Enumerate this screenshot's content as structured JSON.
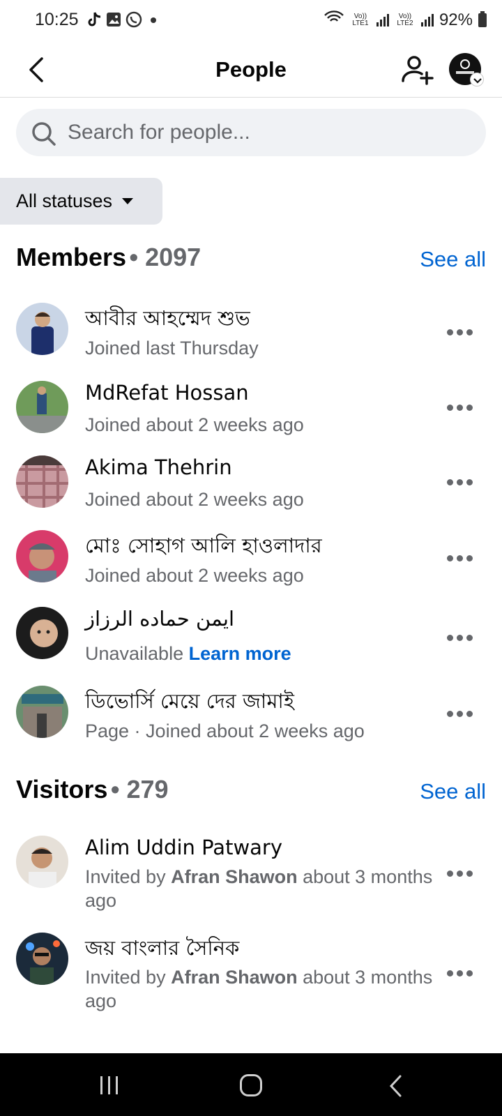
{
  "status_bar": {
    "time": "10:25",
    "lte1": "Vo)) LTE1",
    "lte2": "Vo)) LTE2",
    "battery": "92%"
  },
  "header": {
    "title": "People"
  },
  "search": {
    "placeholder": "Search for people..."
  },
  "filter": {
    "label": "All statuses"
  },
  "members": {
    "title": "Members",
    "count": "• 2097",
    "see_all": "See all",
    "items": [
      {
        "name": "আবীর আহম্মেদ শুভ",
        "sub": "Joined last Thursday"
      },
      {
        "name": "MdRefat Hossan",
        "sub": "Joined about 2 weeks ago"
      },
      {
        "name": "Akima Thehrin",
        "sub": "Joined about 2 weeks ago"
      },
      {
        "name": "মোঃ সোহাগ আলি হাওলাদার",
        "sub": "Joined about 2 weeks ago"
      },
      {
        "name": "ايمن حماده الرزاز",
        "sub": "Unavailable",
        "link": "Learn more"
      },
      {
        "name": "ডিভোর্সি মেয়ে দের জামাই",
        "sub": "Page · Joined about 2 weeks ago"
      }
    ]
  },
  "visitors": {
    "title": "Visitors",
    "count": "• 279",
    "see_all": "See all",
    "items": [
      {
        "name": "Alim Uddin Patwary",
        "pre": "Invited by ",
        "inviter": "Afran Shawon",
        "post": " about 3 months ago"
      },
      {
        "name": "জয় বাংলার সৈনিক",
        "pre": "Invited by ",
        "inviter": "Afran Shawon",
        "post": " about 3 months ago"
      }
    ]
  },
  "colors": {
    "accent": "#0064d1",
    "secondary_text": "#65676b",
    "search_bg": "#f0f2f5"
  }
}
